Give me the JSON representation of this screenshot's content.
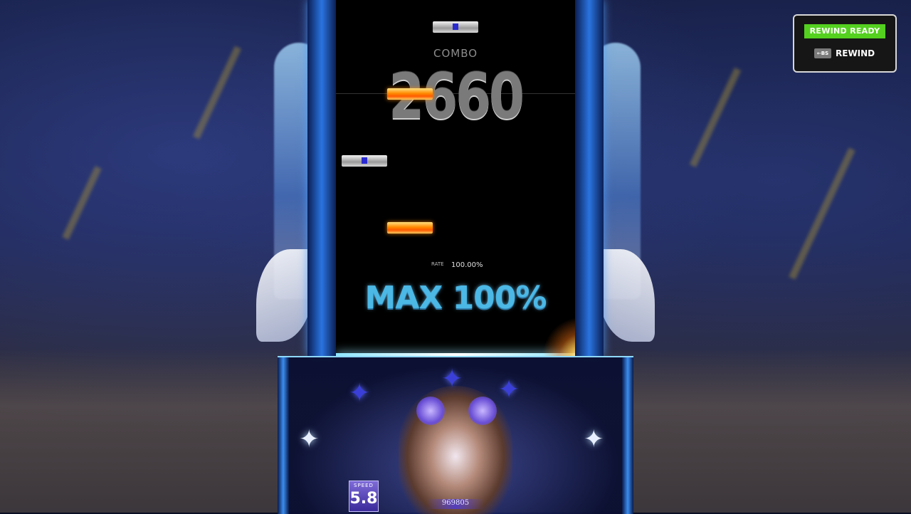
{
  "game": {
    "combo_label": "COMBO",
    "combo_value": "2660",
    "rate_label": "RATE",
    "rate_value": "100.00%",
    "judgement": "MAX 100%",
    "speed_label": "SPEED",
    "speed_value": "5.8",
    "score": "969805"
  },
  "rewind": {
    "status": "REWIND READY",
    "key": "←BS",
    "label": "REWIND"
  },
  "colors": {
    "rewind_ready_bg": "#54d11f",
    "judgement_text": "#4bb8e6",
    "note_orange": "#ff8a00",
    "note_white": "#d8d8d8"
  }
}
